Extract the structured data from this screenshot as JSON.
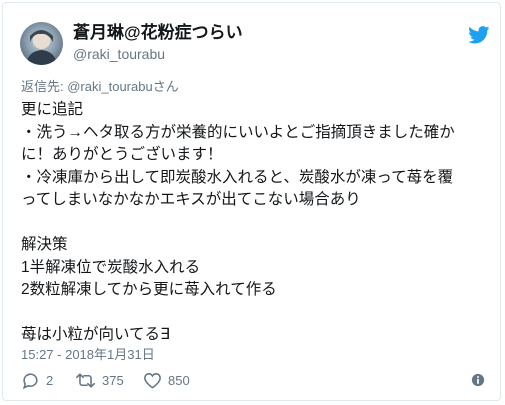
{
  "tweet": {
    "author": {
      "display_name": "蒼月琳@花粉症つらい",
      "handle": "@raki_tourabu"
    },
    "reply_to": {
      "prefix": "返信先: ",
      "mention": "@raki_tourabu",
      "suffix": "さん"
    },
    "body_lines": [
      "更に追記",
      "・洗う→ヘタ取る方が栄養的にいいよとご指摘頂きました確か",
      "に！ありがとうございます！",
      "・冷凍庫から出して即炭酸水入れると、炭酸水が凍って苺を覆",
      "ってしまいなかなかエキスが出てこない場合あり",
      "",
      "解決策",
      "1半解凍位で炭酸水入れる",
      "2数粒解凍してから更に苺入れて作る",
      "",
      "苺は小粒が向いてる∃"
    ],
    "timestamp": "15:27 - 2018年1月31日",
    "actions": {
      "reply_count": "2",
      "retweet_count": "375",
      "like_count": "850"
    }
  },
  "colors": {
    "twitter_blue": "#1da1f2",
    "secondary_text": "#657786",
    "primary_text": "#14171a",
    "border": "#e1e8ed"
  },
  "icons": [
    "twitter-bird-icon",
    "reply-icon",
    "retweet-icon",
    "like-icon",
    "info-icon"
  ]
}
